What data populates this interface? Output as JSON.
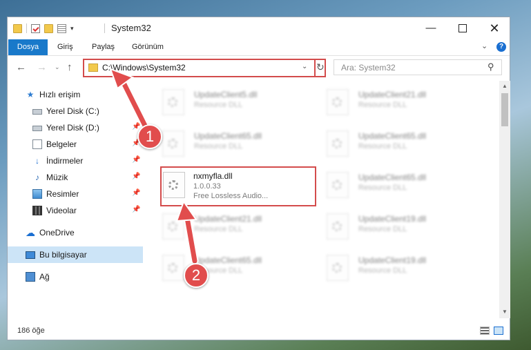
{
  "window": {
    "title": "System32",
    "controls": {
      "minimize": "—",
      "close": "✕"
    }
  },
  "ribbon": {
    "tabs": [
      "Dosya",
      "Giriş",
      "Paylaş",
      "Görünüm"
    ],
    "accent_color": "#1979ca"
  },
  "navigation": {
    "back": "←",
    "forward": "→",
    "up": "↑",
    "address": "C:\\Windows\\System32",
    "search_placeholder": "Ara: System32"
  },
  "sidebar": {
    "items": [
      {
        "label": "Hızlı erişim",
        "icon": "star-icon"
      },
      {
        "label": "Yerel Disk (C:)",
        "icon": "drive-icon",
        "pinned": true
      },
      {
        "label": "Yerel Disk (D:)",
        "icon": "drive-icon",
        "pinned": true
      },
      {
        "label": "Belgeler",
        "icon": "documents-icon",
        "pinned": true
      },
      {
        "label": "İndirmeler",
        "icon": "downloads-icon",
        "pinned": true
      },
      {
        "label": "Müzik",
        "icon": "music-icon",
        "pinned": true
      },
      {
        "label": "Resimler",
        "icon": "pictures-icon",
        "pinned": true
      },
      {
        "label": "Videolar",
        "icon": "videos-icon",
        "pinned": true
      },
      {
        "label": "OneDrive",
        "icon": "onedrive-icon"
      },
      {
        "label": "Bu bilgisayar",
        "icon": "this-pc-icon",
        "selected": true
      },
      {
        "label": "Ağ",
        "icon": "network-icon"
      }
    ]
  },
  "files": [
    {
      "name": "UpdateClient5.dll",
      "type": "Resource DLL"
    },
    {
      "name": "UpdateClient21.dll",
      "type": "Resource DLL"
    },
    {
      "name": "UpdateClient65.dll",
      "type": "Resource DLL"
    },
    {
      "name": "UpdateClient65.dll",
      "type": "Resource DLL"
    },
    {
      "name": "nxmyfla.dll",
      "version": "1.0.0.33",
      "description": "Free Lossless Audio...",
      "highlighted": true
    },
    {
      "name": "UpdateClient65.dll",
      "type": "Resource DLL"
    },
    {
      "name": "UpdateClient21.dll",
      "type": "Resource DLL"
    },
    {
      "name": "UpdateClient19.dll",
      "type": "Resource DLL"
    },
    {
      "name": "UpdateClient65.dll",
      "type": "Resource DLL"
    },
    {
      "name": "UpdateClient19.dll",
      "type": "Resource DLL"
    }
  ],
  "status": {
    "item_count": "186 öğe"
  },
  "callouts": {
    "step1": "1",
    "step2": "2",
    "color": "#e14d4d"
  }
}
